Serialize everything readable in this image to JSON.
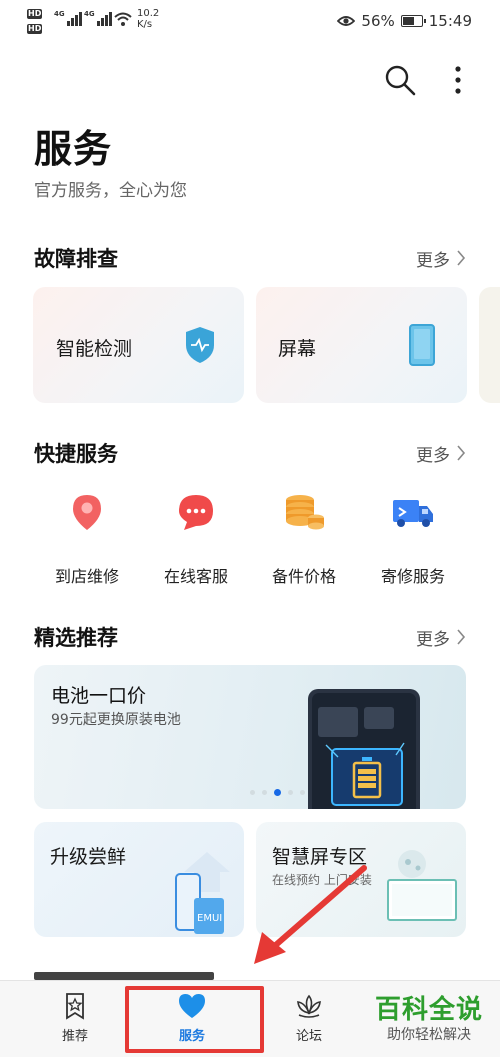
{
  "status_bar": {
    "hd1": "HD",
    "hd2": "HD",
    "sig1_label": "4G",
    "sig2_label": "4G",
    "net_speed_value": "10.2",
    "net_speed_unit": "K/s",
    "battery_percent": "56%",
    "time": "15:49"
  },
  "header": {
    "title": "服务",
    "subtitle": "官方服务，全心为您"
  },
  "troubleshoot": {
    "title": "故障排查",
    "more": "更多",
    "cards": [
      {
        "label": "智能检测",
        "icon": "shield-icon"
      },
      {
        "label": "屏幕",
        "icon": "phone-screen-icon"
      }
    ]
  },
  "quick_services": {
    "title": "快捷服务",
    "more": "更多",
    "items": [
      {
        "label": "到店维修",
        "icon": "location-pin-icon",
        "color": "#f05a5a"
      },
      {
        "label": "在线客服",
        "icon": "chat-bubble-icon",
        "color": "#f04a4a"
      },
      {
        "label": "备件价格",
        "icon": "coins-icon",
        "color": "#f3a13a"
      },
      {
        "label": "寄修服务",
        "icon": "truck-icon",
        "color": "#3b82f6"
      }
    ]
  },
  "featured": {
    "title": "精选推荐",
    "more": "更多",
    "banner": {
      "title": "电池一口价",
      "subtitle": "99元起更换原装电池",
      "page_count": 5,
      "active_page": 3
    },
    "cards": [
      {
        "title": "升级尝鲜",
        "badge": "EMUI"
      },
      {
        "title": "智慧屏专区",
        "subtitle": "在线预约 上门安装"
      }
    ]
  },
  "tab_bar": {
    "tabs": [
      {
        "label": "推荐",
        "icon": "star-bookmark-icon",
        "active": false
      },
      {
        "label": "服务",
        "icon": "heart-icon",
        "active": true
      },
      {
        "label": "论坛",
        "icon": "lotus-icon",
        "active": false
      }
    ]
  },
  "watermark": {
    "title": "百科全说",
    "subtitle": "助你轻松解决"
  },
  "colors": {
    "accent": "#1d7ae0",
    "annotation": "#e53935",
    "watermark": "#2e9e2e"
  }
}
